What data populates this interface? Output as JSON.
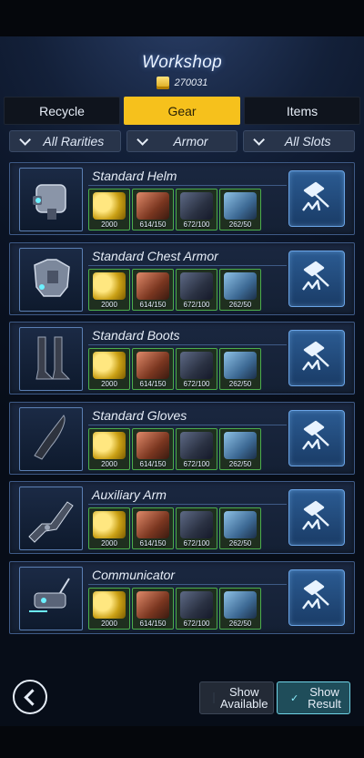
{
  "header": {
    "title": "Workshop",
    "currency_amount": "270031"
  },
  "tabs": [
    {
      "label": "Recycle",
      "active": false
    },
    {
      "label": "Gear",
      "active": true
    },
    {
      "label": "Items",
      "active": false
    }
  ],
  "filters": [
    "All Rarities",
    "Armor",
    "All Slots"
  ],
  "items": [
    {
      "name": "Standard Helm",
      "icon": "helm-icon",
      "materials": [
        {
          "type": "coins",
          "qty": "2000"
        },
        {
          "type": "copper",
          "qty": "614/150"
        },
        {
          "type": "iron",
          "qty": "672/100"
        },
        {
          "type": "crystal",
          "qty": "262/50"
        }
      ]
    },
    {
      "name": "Standard Chest Armor",
      "icon": "chest-armor-icon",
      "materials": [
        {
          "type": "coins",
          "qty": "2000"
        },
        {
          "type": "copper",
          "qty": "614/150"
        },
        {
          "type": "iron",
          "qty": "672/100"
        },
        {
          "type": "crystal",
          "qty": "262/50"
        }
      ]
    },
    {
      "name": "Standard Boots",
      "icon": "boots-icon",
      "materials": [
        {
          "type": "coins",
          "qty": "2000"
        },
        {
          "type": "copper",
          "qty": "614/150"
        },
        {
          "type": "iron",
          "qty": "672/100"
        },
        {
          "type": "crystal",
          "qty": "262/50"
        }
      ]
    },
    {
      "name": "Standard Gloves",
      "icon": "glove-icon",
      "materials": [
        {
          "type": "coins",
          "qty": "2000"
        },
        {
          "type": "copper",
          "qty": "614/150"
        },
        {
          "type": "iron",
          "qty": "672/100"
        },
        {
          "type": "crystal",
          "qty": "262/50"
        }
      ]
    },
    {
      "name": "Auxiliary Arm",
      "icon": "arm-icon",
      "materials": [
        {
          "type": "coins",
          "qty": "2000"
        },
        {
          "type": "copper",
          "qty": "614/150"
        },
        {
          "type": "iron",
          "qty": "672/100"
        },
        {
          "type": "crystal",
          "qty": "262/50"
        }
      ]
    },
    {
      "name": "Communicator",
      "icon": "communicator-icon",
      "materials": [
        {
          "type": "coins",
          "qty": "2000"
        },
        {
          "type": "copper",
          "qty": "614/150"
        },
        {
          "type": "iron",
          "qty": "672/100"
        },
        {
          "type": "crystal",
          "qty": "262/50"
        }
      ]
    }
  ],
  "footer": {
    "show_available_line1": "Show",
    "show_available_line2": "Available",
    "show_available_checked": false,
    "show_result_line1": "Show",
    "show_result_line2": "Result",
    "show_result_checked": true
  },
  "colors": {
    "accent": "#f6c11c",
    "row_border": "#3e5a86",
    "craft_button": "#2b5b92",
    "material_border": "#4cae4c"
  }
}
